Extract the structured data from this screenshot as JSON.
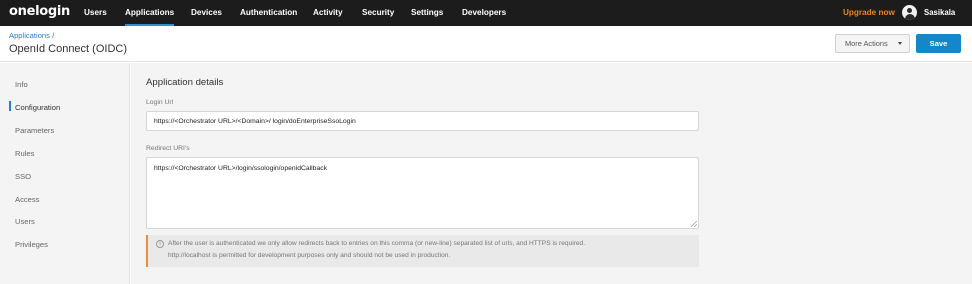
{
  "brand": {
    "logo_text": "onelogin"
  },
  "nav": {
    "items": [
      "Users",
      "Applications",
      "Devices",
      "Authentication",
      "Activity",
      "Security",
      "Settings",
      "Developers"
    ],
    "active": "Applications",
    "upgrade_label": "Upgrade now",
    "user_name": "Sasikala"
  },
  "header": {
    "breadcrumb": "Applications",
    "breadcrumb_sep": " /",
    "title": "OpenId Connect (OIDC)",
    "more_actions_label": "More Actions",
    "save_label": "Save"
  },
  "sidebar": {
    "items": [
      "Info",
      "Configuration",
      "Parameters",
      "Rules",
      "SSO",
      "Access",
      "Users",
      "Privileges"
    ],
    "active": "Configuration"
  },
  "details": {
    "section_title": "Application details",
    "login_url_label": "Login Url",
    "login_url_value": "https://<Orchestrator URL>/<Domain>/ login/doEnterpriseSsoLogin",
    "redirect_label": "Redirect URI's",
    "redirect_value": "https://<Orchestrator URL>/login/ssologin/openidCallback",
    "notice_line1": "After the user is authenticated we only allow redirects back to entries on this comma (or new-line) separated list of urls, and HTTPS is required.",
    "notice_line2": "http://localhost is permitted for development purposes only and should not be used in production."
  },
  "colors": {
    "topbar": "#1c1c1c",
    "accent": "#1587c8",
    "upgrade": "#f0821e",
    "notice_border": "#ef8a3d"
  },
  "icons": {
    "info": "info-circle-icon",
    "caret": "caret-down-icon",
    "avatar": "user-avatar-icon"
  }
}
